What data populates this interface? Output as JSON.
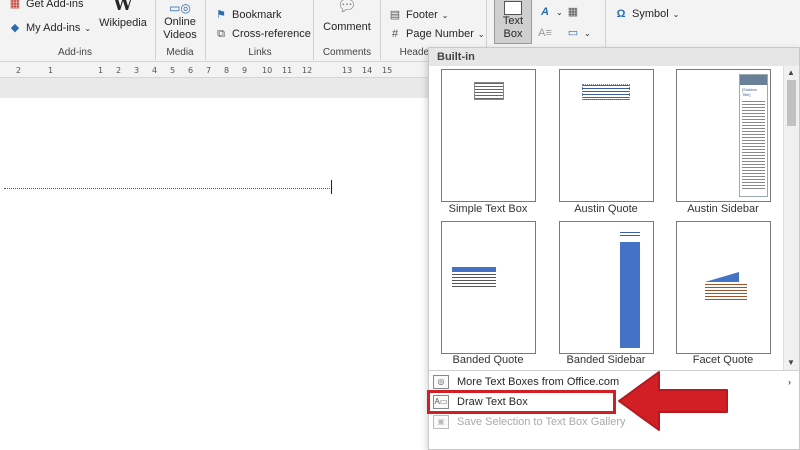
{
  "ribbon": {
    "addins": {
      "get_addins": "Get Add-ins",
      "my_addins": "My Add-ins",
      "wikipedia": "Wikipedia",
      "group_label": "Add-ins"
    },
    "media": {
      "online_videos_line1": "Online",
      "online_videos_line2": "Videos",
      "group_label": "Media"
    },
    "links": {
      "bookmark": "Bookmark",
      "cross_reference": "Cross-reference",
      "group_label": "Links"
    },
    "comments": {
      "comment": "Comment",
      "group_label": "Comments"
    },
    "header_footer": {
      "footer": "Footer",
      "page_number": "Page Number",
      "group_label": "Header"
    },
    "text": {
      "text_box_line1": "Text",
      "text_box_line2": "Box"
    },
    "symbols": {
      "symbol": "Symbol",
      "omega": "Ω"
    }
  },
  "ruler": {
    "ticks": [
      "2",
      "1",
      "1",
      "2",
      "3",
      "4",
      "5",
      "6",
      "7",
      "8",
      "9",
      "10",
      "11",
      "12",
      "13",
      "14",
      "15"
    ]
  },
  "dropdown": {
    "header": "Built-in",
    "thumbnails": [
      {
        "label": "Simple Text Box"
      },
      {
        "label": "Austin Quote"
      },
      {
        "label": "Austin Sidebar"
      },
      {
        "label": "Banded Quote"
      },
      {
        "label": "Banded Sidebar"
      },
      {
        "label": "Facet Quote"
      }
    ],
    "austin_sidebar_heading": "[Sidebar Title]",
    "menu": {
      "more_text_boxes": "More Text Boxes from Office.com",
      "draw_text_box": "Draw Text Box",
      "save_selection": "Save Selection to Text Box Gallery"
    }
  },
  "colors": {
    "highlight": "#d21f26",
    "banded_blue": "#4472c4"
  }
}
